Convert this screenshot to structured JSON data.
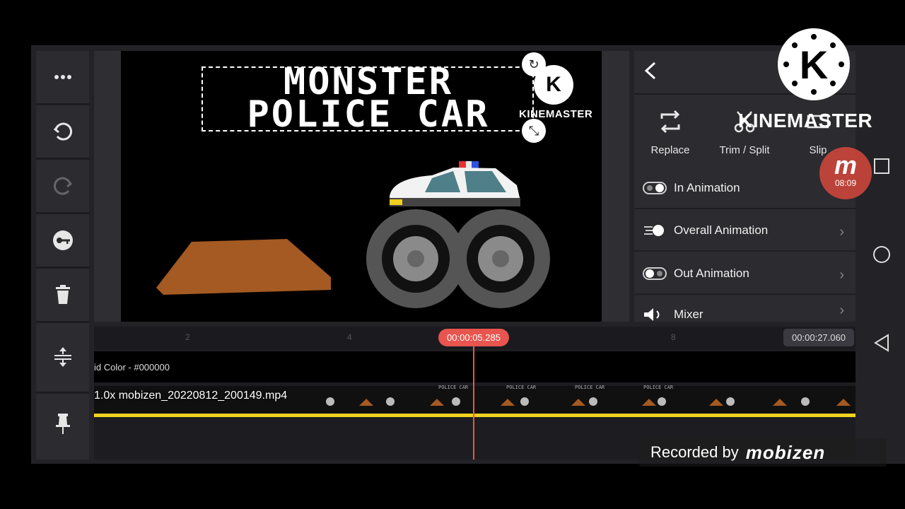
{
  "preview": {
    "title_line1": "MONSTER",
    "title_line2": "POLICE CAR",
    "watermark_text": "KINEMASTER",
    "watermark_logo": "K"
  },
  "toolbar": {
    "items": [
      {
        "name": "more-icon"
      },
      {
        "name": "undo-icon"
      },
      {
        "name": "redo-icon"
      },
      {
        "name": "key-icon"
      },
      {
        "name": "trash-icon"
      },
      {
        "name": "track-height-icon"
      },
      {
        "name": "pin-icon"
      }
    ]
  },
  "panel": {
    "actions": [
      {
        "label": "Replace",
        "icon": "replace-icon"
      },
      {
        "label": "Trim / Split",
        "icon": "scissors-icon"
      },
      {
        "label": "Slip",
        "icon": "slip-icon"
      }
    ],
    "overlay_text": "KINEMASTER",
    "menu": [
      {
        "label": "In Animation",
        "icon": "in-animation-icon"
      },
      {
        "label": "Overall Animation",
        "icon": "overall-animation-icon"
      },
      {
        "label": "Out Animation",
        "icon": "out-animation-icon"
      },
      {
        "label": "Mixer",
        "icon": "mixer-icon"
      }
    ]
  },
  "logo": {
    "letter": "K"
  },
  "rec_badge": {
    "letter": "m",
    "time": "08:09"
  },
  "timeline": {
    "ticks": [
      "2",
      "4",
      "8"
    ],
    "current_time": "00:00:05.285",
    "end_time": "00:00:27.060",
    "color_track_label": "id Color - #000000",
    "video_track_label": "1.0x mobizen_20220812_200149.mp4",
    "thumb_caption": "POLICE CAR"
  },
  "recorded": {
    "text": "Recorded by",
    "brand": "mobizen"
  },
  "colors": {
    "accent": "#e8554e",
    "track_yellow": "#f2d321",
    "dirt": "#a45a22"
  }
}
